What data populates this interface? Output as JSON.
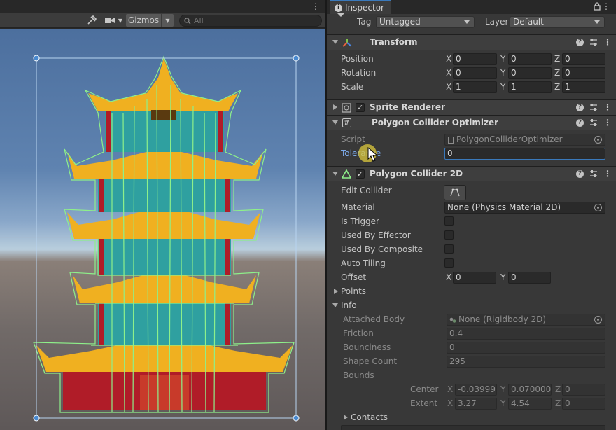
{
  "scene": {
    "gizmos_label": "Gizmos",
    "search_placeholder": "All",
    "icons": [
      "tools-icon",
      "camera-icon",
      "chevron-down-icon",
      "search-icon",
      "kebab-menu-icon"
    ]
  },
  "inspector": {
    "tab_label": "Inspector",
    "tag_label": "Tag",
    "tag_value": "Untagged",
    "layer_label": "Layer",
    "layer_value": "Default"
  },
  "transform": {
    "title": "Transform",
    "rows": [
      {
        "label": "Position",
        "x": "0",
        "y": "0",
        "z": "0"
      },
      {
        "label": "Rotation",
        "x": "0",
        "y": "0",
        "z": "0"
      },
      {
        "label": "Scale",
        "x": "1",
        "y": "1",
        "z": "1"
      }
    ]
  },
  "sprite_renderer": {
    "title": "Sprite Renderer",
    "enabled": true
  },
  "optimizer": {
    "title": "Polygon Collider Optimizer",
    "script_label": "Script",
    "script_value": "PolygonColliderOptimizer",
    "tolerance_label": "Tolerance",
    "tolerance_value": "0"
  },
  "collider": {
    "title": "Polygon Collider 2D",
    "enabled": true,
    "edit_collider_label": "Edit Collider",
    "material_label": "Material",
    "material_value": "None (Physics Material 2D)",
    "is_trigger_label": "Is Trigger",
    "used_by_effector_label": "Used By Effector",
    "used_by_composite_label": "Used By Composite",
    "auto_tiling_label": "Auto Tiling",
    "offset_label": "Offset",
    "offset_x": "0",
    "offset_y": "0",
    "points_label": "Points",
    "info_label": "Info",
    "info": {
      "attached_body_label": "Attached Body",
      "attached_body_value": "None (Rigidbody 2D)",
      "friction_label": "Friction",
      "friction_value": "0.4",
      "bounciness_label": "Bounciness",
      "bounciness_value": "0",
      "shape_count_label": "Shape Count",
      "shape_count_value": "295",
      "bounds_label": "Bounds",
      "center_label": "Center",
      "center_x": "-0.03999",
      "center_y": "0.070000",
      "center_z": "0",
      "extent_label": "Extent",
      "extent_x": "3.27",
      "extent_y": "4.54",
      "extent_z": "0"
    },
    "contacts_label": "Contacts"
  },
  "axis_labels": {
    "x": "X",
    "y": "Y",
    "z": "Z"
  },
  "colors": {
    "accent_blue": "#3a79bb",
    "collider_green": "#8ef08a",
    "panel_bg": "#383838",
    "header_bg": "#3e3e3e"
  }
}
